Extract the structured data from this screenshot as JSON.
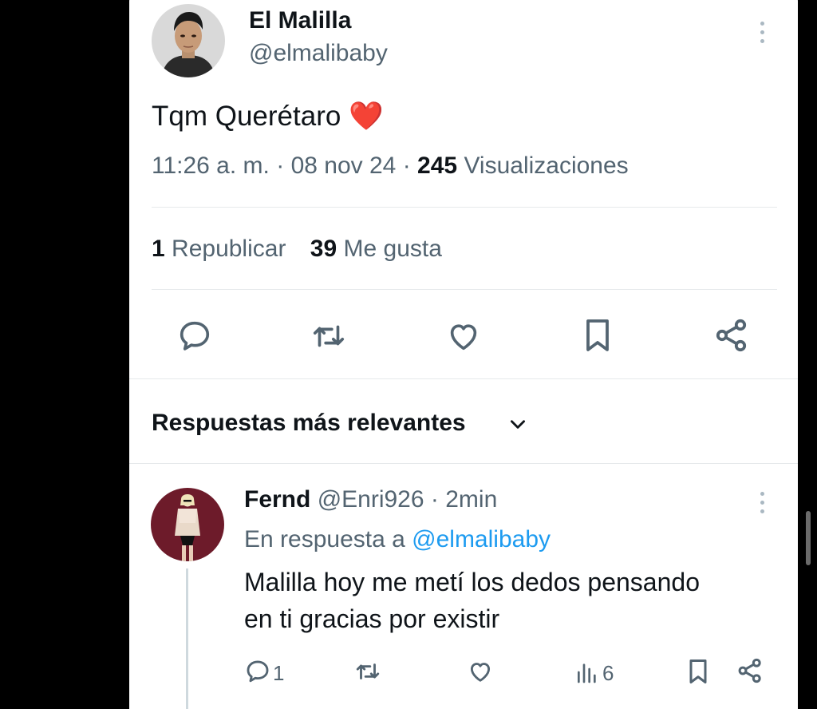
{
  "tweet": {
    "author_name": "El Malilla",
    "author_handle": "@elmalibaby",
    "text": "Tqm Querétaro ❤️",
    "time": "11:26 a. m.",
    "sep1": "·",
    "date": "08 nov 24",
    "sep2": "·",
    "views_count": "245",
    "views_label": "Visualizaciones",
    "reposts_count": "1",
    "reposts_label": "Republicar",
    "likes_count": "39",
    "likes_label": "Me gusta"
  },
  "actions": [
    "reply-icon",
    "repost-icon",
    "like-icon",
    "bookmark-icon",
    "share-icon"
  ],
  "replies_header": {
    "label": "Respuestas más relevantes",
    "icon": "chevron-down-icon"
  },
  "reply": {
    "author_name": "Fernd",
    "author_handle": "@Enri926",
    "sep": "·",
    "time": "2min",
    "in_reply_prefix": "En respuesta a",
    "in_reply_handle": "@elmalibaby",
    "text_line1": "Malilla hoy me metí los dedos pensando",
    "text_line2": "en ti gracias por existir",
    "reply_count": "1",
    "view_count": "6"
  },
  "colors": {
    "background": "#000000",
    "card": "#ffffff",
    "text_primary": "#0f1419",
    "text_secondary": "#536471",
    "link": "#1d9bf0",
    "like_heart": "#f4212e",
    "divider": "#e6e9eb"
  }
}
